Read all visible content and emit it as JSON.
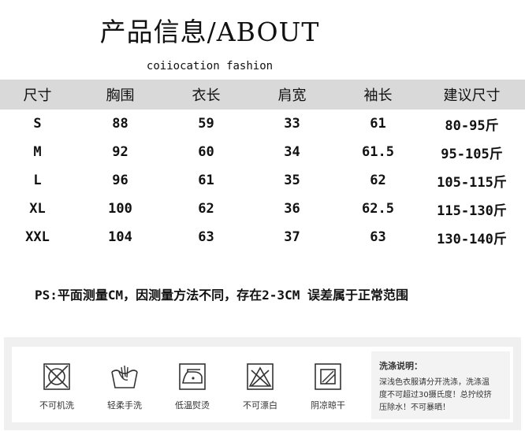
{
  "title": "产品信息/ABOUT",
  "brand": "coiiocation fashion",
  "table": {
    "headers": [
      "尺寸",
      "胸围",
      "衣长",
      "肩宽",
      "袖长",
      "建议尺寸"
    ],
    "rows": [
      [
        "S",
        "88",
        "59",
        "33",
        "61",
        "80-95斤"
      ],
      [
        "M",
        "92",
        "60",
        "34",
        "61.5",
        "95-105斤"
      ],
      [
        "L",
        "96",
        "61",
        "35",
        "62",
        "105-115斤"
      ],
      [
        "XL",
        "100",
        "62",
        "36",
        "62.5",
        "115-130斤"
      ],
      [
        "XXL",
        "104",
        "63",
        "37",
        "63",
        "130-140斤"
      ]
    ]
  },
  "note": "PS:平面测量CM，因测量方法不同，存在2-3CM 误差属于正常范围",
  "care": {
    "items": [
      {
        "icon": "no-machine-wash-icon",
        "label": "不可机洗"
      },
      {
        "icon": "hand-wash-icon",
        "label": "轻柔手洗"
      },
      {
        "icon": "low-iron-icon",
        "label": "低温熨烫"
      },
      {
        "icon": "no-bleach-icon",
        "label": "不可漂白"
      },
      {
        "icon": "shade-dry-icon",
        "label": "阴凉晾干"
      }
    ],
    "wash_title": "洗涤说明：",
    "wash_lines": [
      "深浅色衣服请分开洗涤，洗涤温",
      "度不可超过30摄氏度！总拧绞挤",
      "压除水！不可暴晒！"
    ]
  }
}
